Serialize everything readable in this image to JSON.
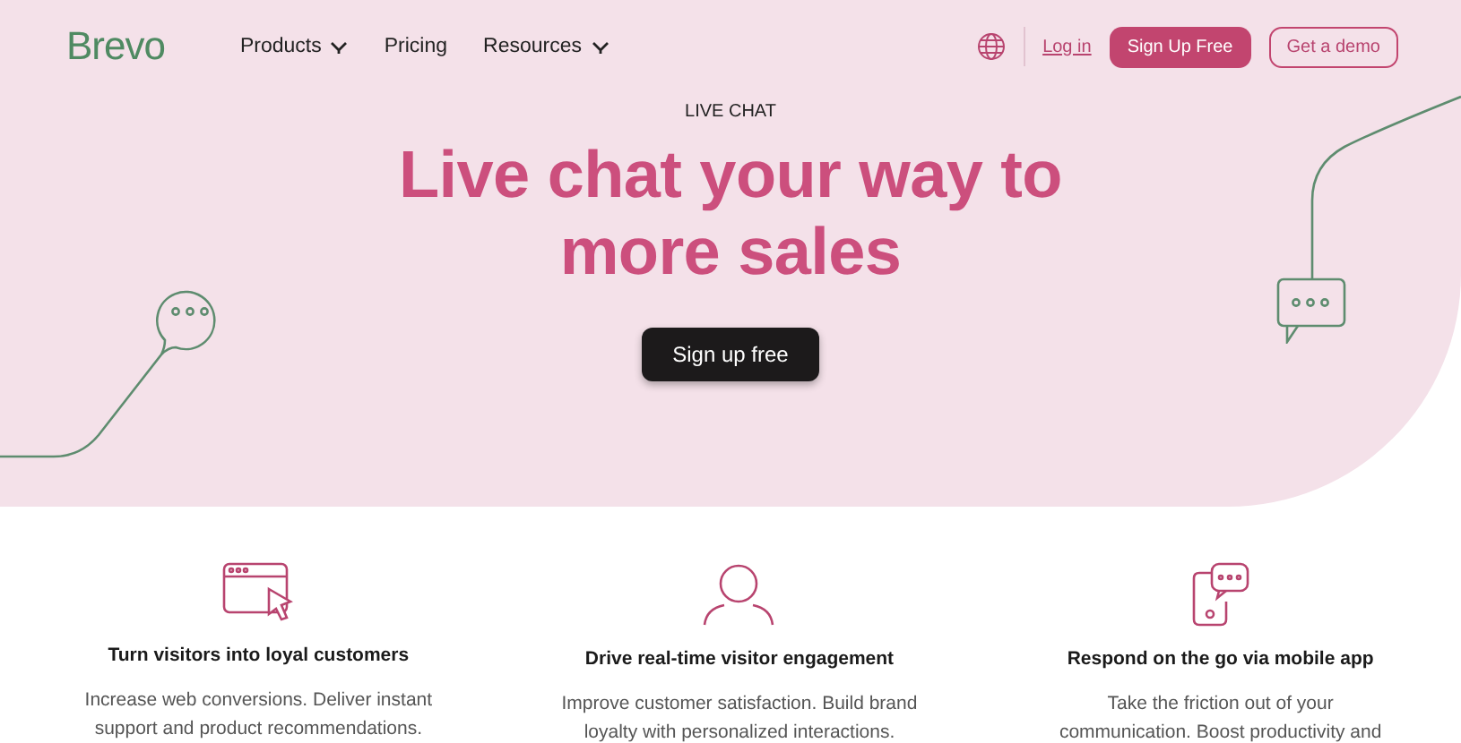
{
  "nav": {
    "logo": "Brevo",
    "links": [
      {
        "label": "Products",
        "dropdown": true
      },
      {
        "label": "Pricing",
        "dropdown": false
      },
      {
        "label": "Resources",
        "dropdown": true
      }
    ],
    "login": "Log in",
    "signup": "Sign Up Free",
    "demo": "Get a demo"
  },
  "hero": {
    "eyebrow": "LIVE CHAT",
    "title": "Live chat your way to\nmore sales",
    "cta": "Sign up free"
  },
  "features": [
    {
      "kind": "browser",
      "title": "Turn visitors into loyal customers",
      "text": "Increase web conversions. Deliver instant\nsupport and product recommendations."
    },
    {
      "kind": "person",
      "title": "Drive real-time visitor engagement",
      "text": "Improve customer satisfaction. Build brand\nloyalty with personalized interactions."
    },
    {
      "kind": "phone",
      "title": "Respond on the go via mobile app",
      "text": "Take the friction out of your\ncommunication. Boost productivity and"
    }
  ]
}
